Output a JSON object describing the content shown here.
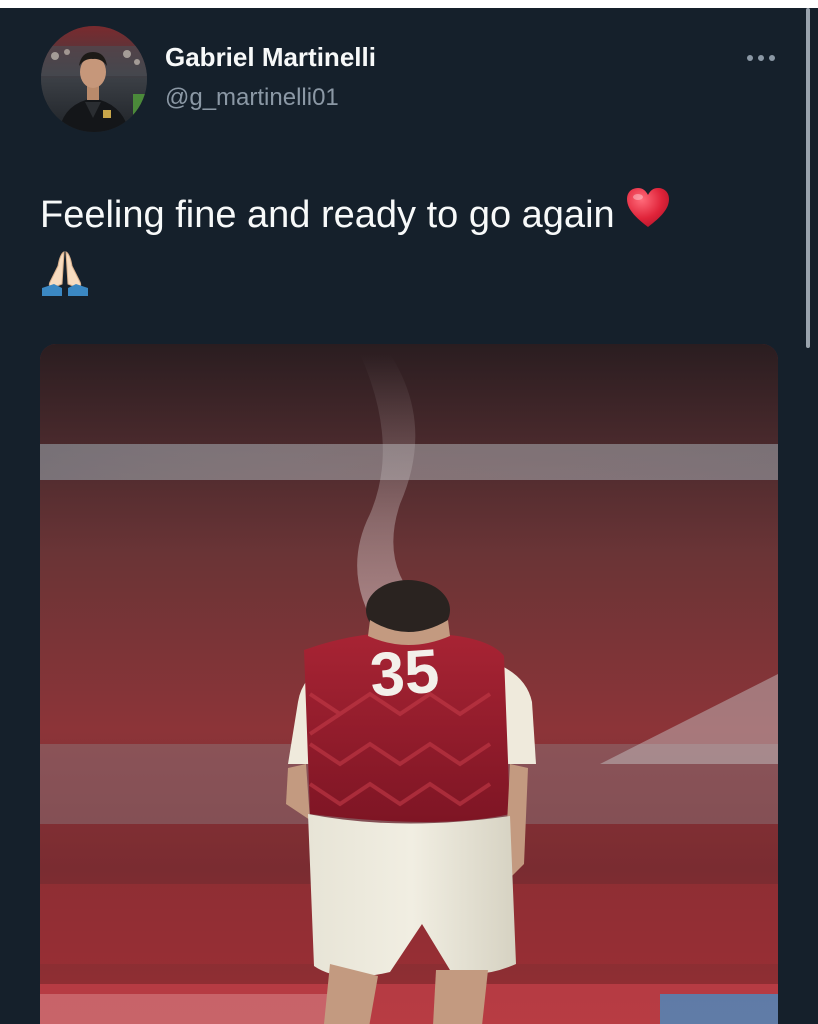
{
  "tweet": {
    "author": {
      "display_name": "Gabriel Martinelli",
      "handle": "@g_martinelli01"
    },
    "text": "Feeling fine and ready to go again",
    "emojis": [
      "red-heart",
      "folded-hands"
    ]
  },
  "photo": {
    "jersey_number": "35"
  },
  "colors": {
    "background": "#15202b",
    "text_primary": "#f7f9f9",
    "text_secondary": "#8b98a5",
    "heart": "#e0245e",
    "jersey_red": "#b3263a"
  },
  "icons": {
    "more": "more-horizontal-icon",
    "heart": "red-heart-icon",
    "pray": "folded-hands-icon"
  }
}
